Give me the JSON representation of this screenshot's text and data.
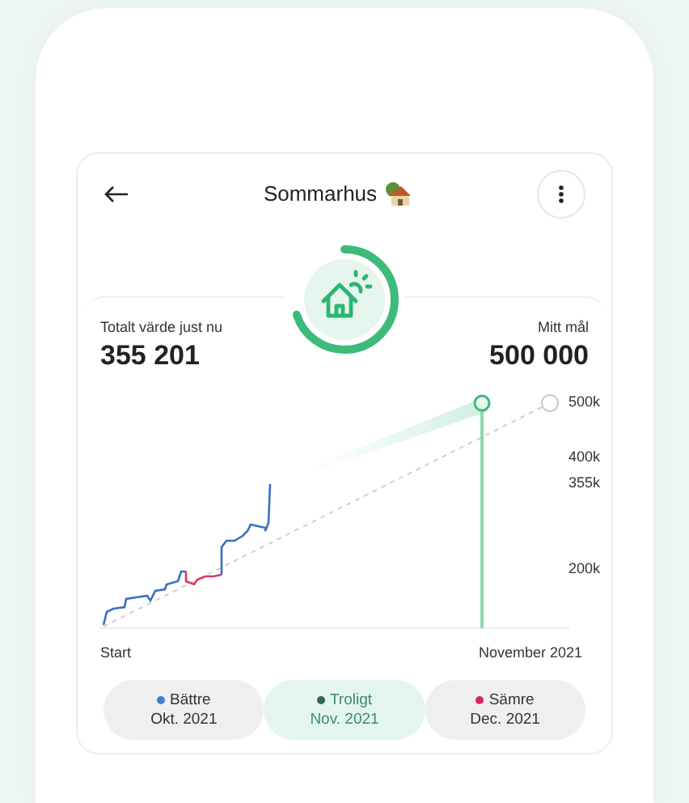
{
  "header": {
    "title": "Sommarhus"
  },
  "progress_ring": {
    "level": 0.7
  },
  "summary": {
    "current_label": "Totalt värde just nu",
    "current_value": "355 201",
    "goal_label": "Mitt mål",
    "goal_value": "500 000"
  },
  "chart": {
    "y_labels": [
      "500k",
      "400k",
      "355k",
      "200k"
    ],
    "x_start": "Start",
    "x_end": "November 2021"
  },
  "scenarios": [
    {
      "name": "Bättre",
      "date": "Okt. 2021",
      "color": "#3b7dd8",
      "selected": false
    },
    {
      "name": "Troligt",
      "date": "Nov. 2021",
      "color": "#2f6b4f",
      "selected": true
    },
    {
      "name": "Sämre",
      "date": "Dec. 2021",
      "color": "#e0245e",
      "selected": false
    }
  ]
}
